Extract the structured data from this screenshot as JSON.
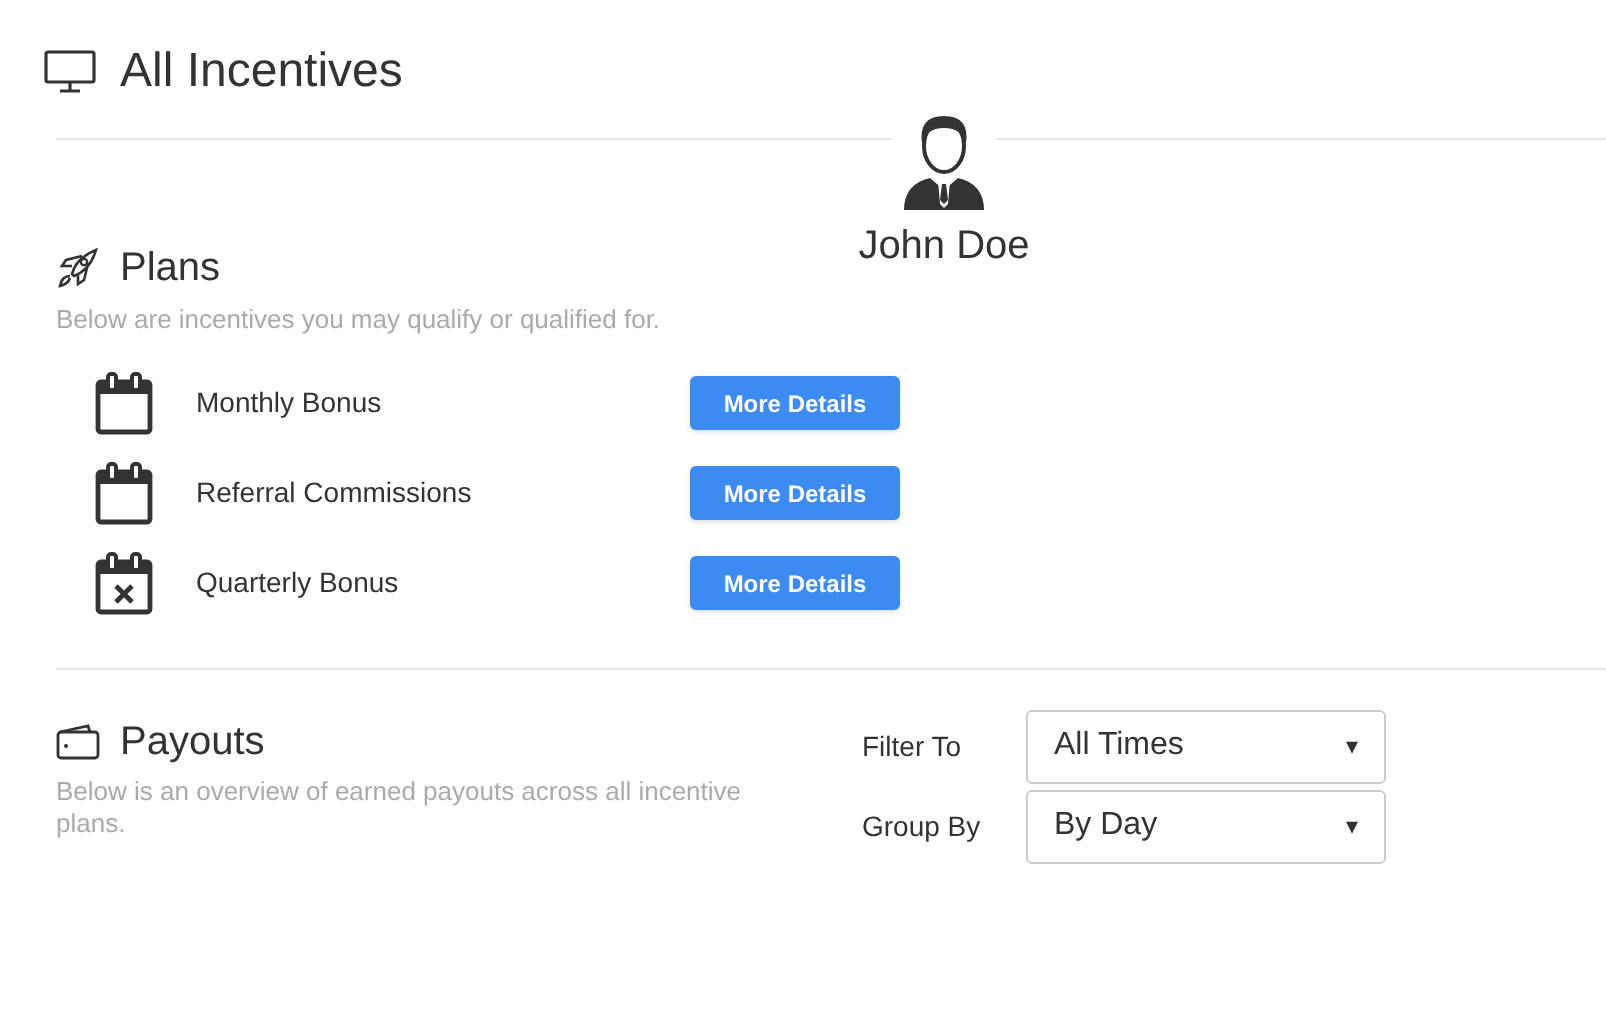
{
  "page_title": "All Incentives",
  "user": {
    "name": "John Doe"
  },
  "plans": {
    "title": "Plans",
    "description": "Below are incentives you may qualify or qualified for.",
    "items": [
      {
        "label": "Monthly Bonus",
        "kind": "open",
        "button": "More Details"
      },
      {
        "label": "Referral Commissions",
        "kind": "open",
        "button": "More Details"
      },
      {
        "label": "Quarterly Bonus",
        "kind": "cancelled",
        "button": "More Details"
      }
    ]
  },
  "payouts": {
    "title": "Payouts",
    "description": "Below is an overview of earned payouts across all incentive plans.",
    "filters": [
      {
        "label": "Filter To",
        "value": "All Times",
        "arrow": "▾"
      },
      {
        "label": "Group By",
        "value": "By Day",
        "arrow": "▾"
      }
    ]
  }
}
